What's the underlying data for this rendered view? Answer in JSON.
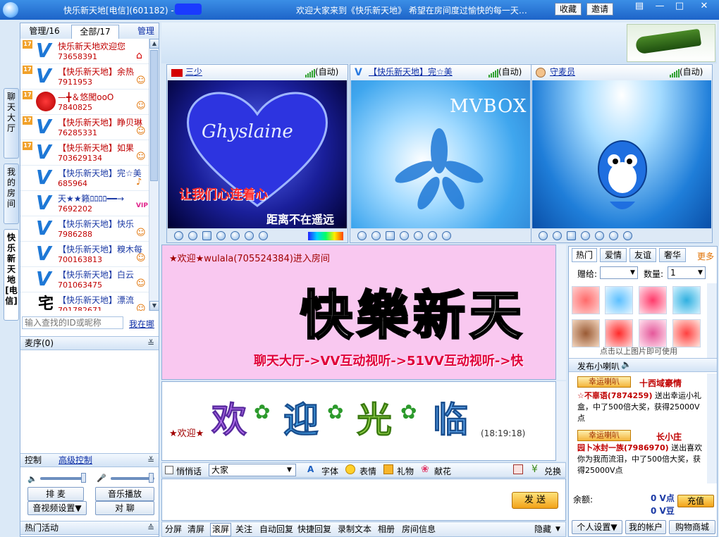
{
  "titlebar": {
    "title": "快乐新天地[电信](601182) -",
    "welcome": "欢迎大家来到《快乐新天地》 希望在房间度过愉快的每一天…",
    "collect": "收藏",
    "invite": "邀请"
  },
  "side_tabs": [
    "聊天大厅",
    "我的房间",
    "快乐新天地[电信]"
  ],
  "left": {
    "tab_manage": "管理/16",
    "tab_all": "全部/17",
    "manage_link": "管理",
    "users": [
      {
        "name": "快乐新天地欢迎您",
        "id": "73658391",
        "icon": "home-icon"
      },
      {
        "name": "【快乐新天地】余热",
        "id": "7911953",
        "icon": "user-icon"
      },
      {
        "name": "—╋＆悠闖ooO",
        "id": "7840825",
        "icon": "user-icon"
      },
      {
        "name": "【快乐新天地】睁贝琳",
        "id": "76285331",
        "icon": "user-icon"
      },
      {
        "name": "【快乐新天地】如果",
        "id": "703629134",
        "icon": "user-icon"
      },
      {
        "name": "【快乐新天地】完☆美",
        "id": "685964",
        "icon": "mic-icon"
      },
      {
        "name": "天★★籁ﾛﾛﾛﾛ━━→",
        "id": "7692202",
        "icon": "vip-icon"
      },
      {
        "name": "【快乐新天地】快乐",
        "id": "7986288",
        "icon": "user-icon"
      },
      {
        "name": "【快乐新天地】糗木每",
        "id": "700163813",
        "icon": "user-icon"
      },
      {
        "name": "【快乐新天地】白云",
        "id": "701063475",
        "icon": "user-icon"
      },
      {
        "name": "【快乐新天地】漂流",
        "id": "701782671",
        "icon": "user-icon"
      }
    ],
    "search_placeholder": "输入查找的ID或昵称",
    "search_link": "我在哪",
    "mic_queue": "麦序(0)",
    "control": "控制",
    "advanced_control": "高级控制",
    "btn_queue": "排 麦",
    "btn_music": "音乐播放",
    "btn_av": "音视频设置▼",
    "btn_private": "对 聊",
    "hot_events": "热门活动"
  },
  "videos": [
    {
      "name": "三少",
      "auto": "(自动)",
      "overlay": "让我们心连着心",
      "overlay2": "距离不在遥远",
      "art": "Ghyslaine"
    },
    {
      "name": "【快乐新天地】完☆美",
      "auto": "(自动)",
      "overlay": "",
      "art": "MVBOX"
    },
    {
      "name": "守麦员",
      "auto": "(自动)",
      "overlay": "",
      "art": ""
    }
  ],
  "chat": {
    "public_line": "★欢迎★wulala(705524384)进入房间",
    "banner_big": "快樂新天",
    "banner_scroll": "聊天大厅->VV互动视听->51VV互动视听->快",
    "private_prefix": "★欢迎★",
    "welcome_art": [
      "欢",
      "迎",
      "光",
      "临"
    ],
    "private_time": "(18:19:18)"
  },
  "inputbar": {
    "whisper": "悄悄话",
    "target": "大家",
    "font": "字体",
    "emoji": "表情",
    "gift": "礼物",
    "flower": "献花",
    "exchange": "兑换",
    "send": "发 送"
  },
  "bottombar": [
    "分屏",
    "清屏",
    "滚屏",
    "关注",
    "自动回复",
    "快捷回复",
    "录制文本",
    "相册",
    "房间信息"
  ],
  "bottombar_hide": "隐藏",
  "right": {
    "tabs": [
      "热门",
      "爱情",
      "友谊",
      "奢华"
    ],
    "more": "更多",
    "gift_to": "赠给:",
    "quantity_label": "数量:",
    "quantity": "1",
    "gift_hint": "点击以上图片即可使用",
    "broadcast": "发布小喇叭",
    "lucky": "幸运喇叭",
    "msg1_user": "十西域豪情",
    "msg1_b": "☆不辜语(7874259)",
    "msg1_c": "送出幸运小礼盒，中了500倍大奖，获得25000V点",
    "msg2_user": "长小庄",
    "msg2_b": "园卜冰封一族(7986970)",
    "msg2_c": "送出喜欢你为我而流泪，中了500倍大奖，获得25000V点",
    "balance_label": "余额:",
    "balance_vpoint": "0 V点",
    "balance_vdou": "0 V豆",
    "recharge": "充值",
    "personal": "个人设置▼",
    "account": "我的帐户",
    "shop": "购物商城"
  },
  "colors": {
    "accent": "#1d64c8",
    "name_red": "#c00000",
    "public_bg": "#f9c8f0"
  }
}
